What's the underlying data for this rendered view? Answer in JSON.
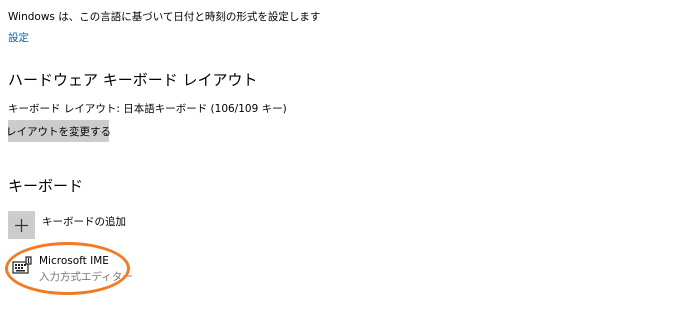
{
  "region": {
    "description": "Windows は、この言語に基づいて日付と時刻の形式を設定します",
    "settings_link": "設定"
  },
  "hardware_keyboard": {
    "heading": "ハードウェア キーボード レイアウト",
    "layout_label": "キーボード レイアウト: 日本語キーボード (106/109 キー)",
    "change_layout_button": "レイアウトを変更する"
  },
  "keyboards": {
    "heading": "キーボード",
    "add_keyboard": {
      "icon": "plus-icon",
      "label": "キーボードの追加"
    },
    "items": [
      {
        "icon": "keyboard-icon",
        "name": "Microsoft IME",
        "subtitle": "入力方式エディター"
      }
    ]
  },
  "colors": {
    "link": "#0063b1",
    "button_bg": "#cccccc",
    "highlight_circle": "#f47a21"
  }
}
